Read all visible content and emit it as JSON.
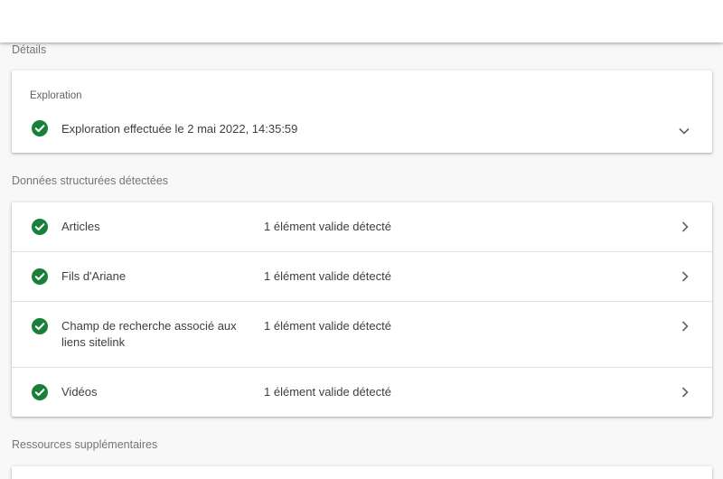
{
  "details": {
    "heading": "Détails",
    "crawl": {
      "label": "Exploration",
      "status": "Exploration effectuée le 2 mai 2022, 14:35:59"
    }
  },
  "structured_data": {
    "heading": "Données structurées détectées",
    "items": [
      {
        "name": "Articles",
        "status": "1 élément valide détecté"
      },
      {
        "name": "Fils d'Ariane",
        "status": "1 élément valide détecté"
      },
      {
        "name": "Champ de recherche associé aux liens sitelink",
        "status": "1 élément valide détecté"
      },
      {
        "name": "Vidéos",
        "status": "1 élément valide détecté"
      }
    ]
  },
  "resources": {
    "heading": "Ressources supplémentaires"
  },
  "colors": {
    "success": "#188038",
    "background": "#f8f8f8",
    "card": "#ffffff"
  },
  "icons": {
    "status": "check-circle-icon",
    "expand": "chevron-down-icon",
    "navigate": "chevron-right-icon"
  }
}
